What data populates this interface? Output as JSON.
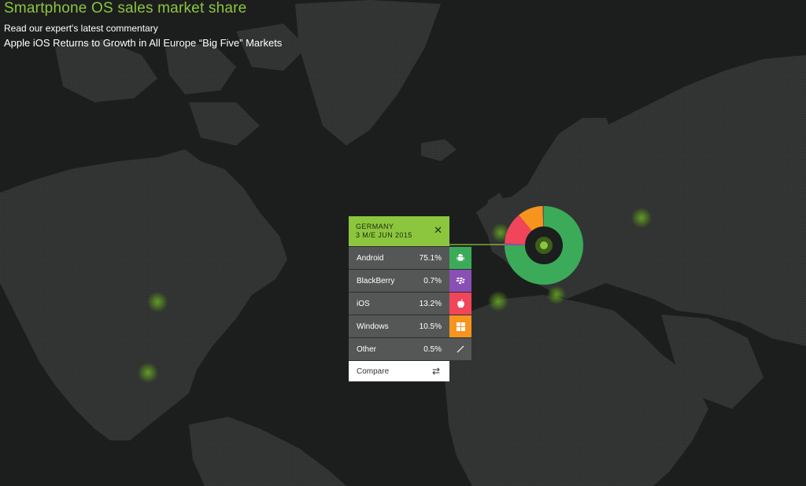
{
  "header": {
    "title": "Smartphone OS sales market share",
    "commentary_link": "Read our expert's latest commentary",
    "headline_link": "Apple iOS Returns to Growth in All Europe “Big Five” Markets"
  },
  "panel": {
    "country": "GERMANY",
    "period": "3 M/E JUN 2015",
    "close_label": "✕",
    "rows": [
      {
        "os": "Android",
        "share": "75.1%",
        "icon": "android-icon",
        "color": "#3bab5a",
        "value": 75.1
      },
      {
        "os": "BlackBerry",
        "share": "0.7%",
        "icon": "blackberry-icon",
        "color": "#8a4fb5",
        "value": 0.7
      },
      {
        "os": "iOS",
        "share": "13.2%",
        "icon": "apple-icon",
        "color": "#f0455a",
        "value": 13.2
      },
      {
        "os": "Windows",
        "share": "10.5%",
        "icon": "windows-icon",
        "color": "#f7941d",
        "value": 10.5
      },
      {
        "os": "Other",
        "share": "0.5%",
        "icon": "other-icon",
        "color": "#555756",
        "value": 0.5
      }
    ],
    "compare_label": "Compare",
    "compare_icon": "swap-arrows-icon"
  },
  "colors": {
    "accent": "#8cc63e",
    "map_land": "#333534",
    "map_water": "#1c1e1d"
  }
}
